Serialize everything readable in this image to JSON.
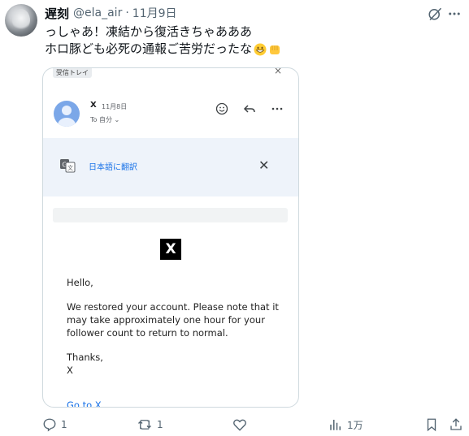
{
  "tweet": {
    "author_name": "遅刻",
    "handle": "@ela_air",
    "separator": "·",
    "date": "11月9日",
    "text_line1": "っしゃあ！凍結から復活きちゃあああ",
    "text_line2": "ホロ豚ども必死の通報ご苦労だったな",
    "emojis": [
      "grinning-face-emoji",
      "oncoming-fist-emoji"
    ]
  },
  "email_screenshot": {
    "inbox_label": "受信トレイ",
    "sender_name": "X",
    "sender_date": "11月8日",
    "to_label": "To 自分 ⌄",
    "translate_label": "日本語に翻訳",
    "logo_text": "X",
    "body": {
      "greeting": "Hello,",
      "message": "We restored your account. Please note that it may take approximately one hour for your follower count to return to normal.",
      "signoff": "Thanks,",
      "signature": "X"
    },
    "link_text": "Go to X"
  },
  "actions": {
    "reply_count": "1",
    "retweet_count": "1",
    "like_count": "",
    "views_count": "1万"
  }
}
